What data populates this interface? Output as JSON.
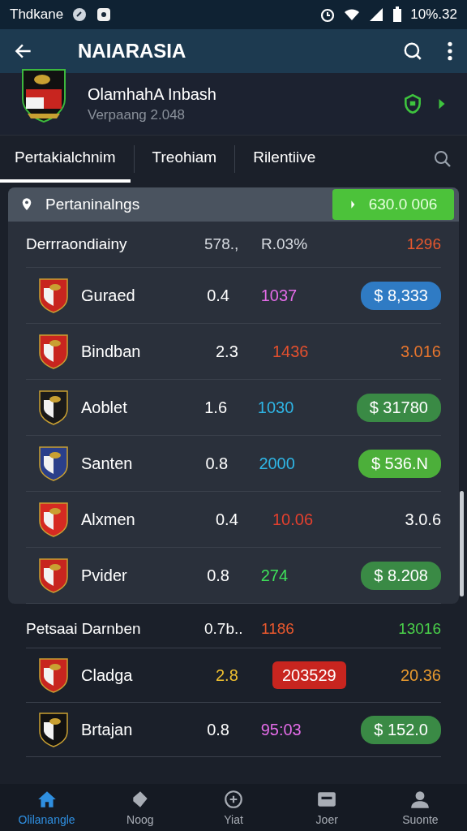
{
  "status_bar": {
    "carrier": "Thdkane",
    "battery_time": "10%.32"
  },
  "app_bar": {
    "title": "NAIARASIA"
  },
  "profile": {
    "name": "OlamhahA Inbash",
    "subtitle": "Verpaang 2.048"
  },
  "tabs": [
    {
      "label": "Pertakialchnim",
      "selected": true
    },
    {
      "label": "Treohiam",
      "selected": false
    },
    {
      "label": "Rilentiive",
      "selected": false
    }
  ],
  "sections": [
    {
      "title": "Pertaninalngs",
      "badge": "630.0 006",
      "columns": [
        {
          "text": "Derrraondiainy"
        },
        {
          "text": "578.,",
          "color": "#d8dce2"
        },
        {
          "text": "R.03%",
          "color": "#d8dce2"
        },
        {
          "text": "1296",
          "color": "#e8582e"
        }
      ],
      "rows": [
        {
          "name": "Guraed",
          "a": {
            "text": "0.4",
            "color": "#ffffff",
            "kind": "plain"
          },
          "b": {
            "text": "1037",
            "color": "#e46ce8",
            "kind": "plain"
          },
          "c": {
            "text": "$ 8,333",
            "color": "#2f7bc4",
            "kind": "pill"
          }
        },
        {
          "name": "Bindban",
          "a": {
            "text": "2.3",
            "color": "#ffffff",
            "kind": "plain"
          },
          "b": {
            "text": "1436",
            "color": "#e5502e",
            "kind": "plain"
          },
          "c": {
            "text": "3.016",
            "color": "#e8762e",
            "kind": "plain"
          }
        },
        {
          "name": "Aoblet",
          "a": {
            "text": "1.6",
            "color": "#ffffff",
            "kind": "plain"
          },
          "b": {
            "text": "1030",
            "color": "#2fb6e6",
            "kind": "plain"
          },
          "c": {
            "text": "$ 31780",
            "color": "#3a8a45",
            "kind": "pill"
          }
        },
        {
          "name": "Santen",
          "a": {
            "text": "0.8",
            "color": "#ffffff",
            "kind": "plain"
          },
          "b": {
            "text": "2000",
            "color": "#2fb6e6",
            "kind": "plain"
          },
          "c": {
            "text": "$ 536.N",
            "color": "#4caf3a",
            "kind": "pill"
          }
        },
        {
          "name": "Alxmen",
          "a": {
            "text": "0.4",
            "color": "#ffffff",
            "kind": "plain"
          },
          "b": {
            "text": "10.06",
            "color": "#e5402e",
            "kind": "plain"
          },
          "c": {
            "text": "3.0.6",
            "color": "#ffffff",
            "kind": "plain"
          }
        },
        {
          "name": "Pvider",
          "a": {
            "text": "0.8",
            "color": "#ffffff",
            "kind": "plain"
          },
          "b": {
            "text": "274",
            "color": "#3ee05a",
            "kind": "plain"
          },
          "c": {
            "text": "$ 8.208",
            "color": "#3a8a45",
            "kind": "pill"
          }
        }
      ]
    },
    {
      "columns": [
        {
          "text": "Petsaai Darnben"
        },
        {
          "text": "0.7b..",
          "color": "#ffffff"
        },
        {
          "text": "1186",
          "color": "#e8582e"
        },
        {
          "text": "13016",
          "color": "#4ad04a"
        }
      ],
      "rows": [
        {
          "name": "Cladga",
          "a": {
            "text": "2.8",
            "color": "#f0c030",
            "kind": "plain"
          },
          "b": {
            "text": "203529",
            "color": "#c8251f",
            "kind": "pill"
          },
          "c": {
            "text": "20.36",
            "color": "#e89a2e",
            "kind": "plain"
          }
        },
        {
          "name": "Brtajan",
          "a": {
            "text": "0.8",
            "color": "#ffffff",
            "kind": "plain"
          },
          "b": {
            "text": "95:03",
            "color": "#e46ce8",
            "kind": "plain"
          },
          "c": {
            "text": "$ 152.0",
            "color": "#3a8a45",
            "kind": "pill"
          }
        }
      ]
    }
  ],
  "bottom_nav": [
    {
      "label": "Olilanangle",
      "selected": true
    },
    {
      "label": "Noog",
      "selected": false
    },
    {
      "label": "Yiat",
      "selected": false
    },
    {
      "label": "Joer",
      "selected": false
    },
    {
      "label": "Suonte",
      "selected": false
    }
  ]
}
